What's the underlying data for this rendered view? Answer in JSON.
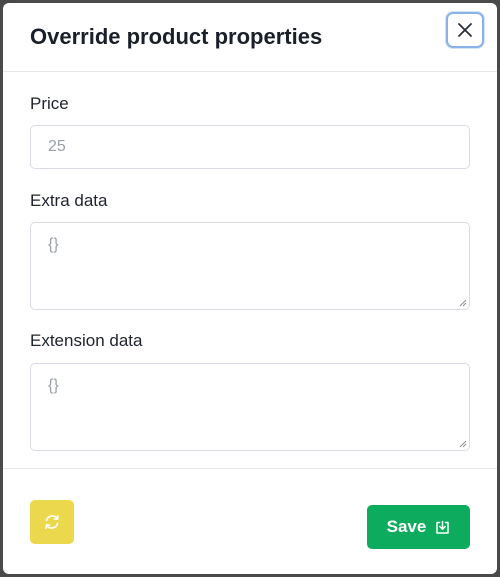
{
  "modal": {
    "title": "Override product properties",
    "close_icon": "close-icon"
  },
  "fields": {
    "price": {
      "label": "Price",
      "placeholder": "25"
    },
    "extra_data": {
      "label": "Extra data",
      "placeholder": "{}"
    },
    "extension_data": {
      "label": "Extension data",
      "placeholder": "{}"
    }
  },
  "footer": {
    "reset_icon": "refresh-icon",
    "save_label": "Save",
    "save_icon": "download-icon",
    "colors": {
      "reset": "#ecd84c",
      "save": "#0cab5d"
    }
  }
}
